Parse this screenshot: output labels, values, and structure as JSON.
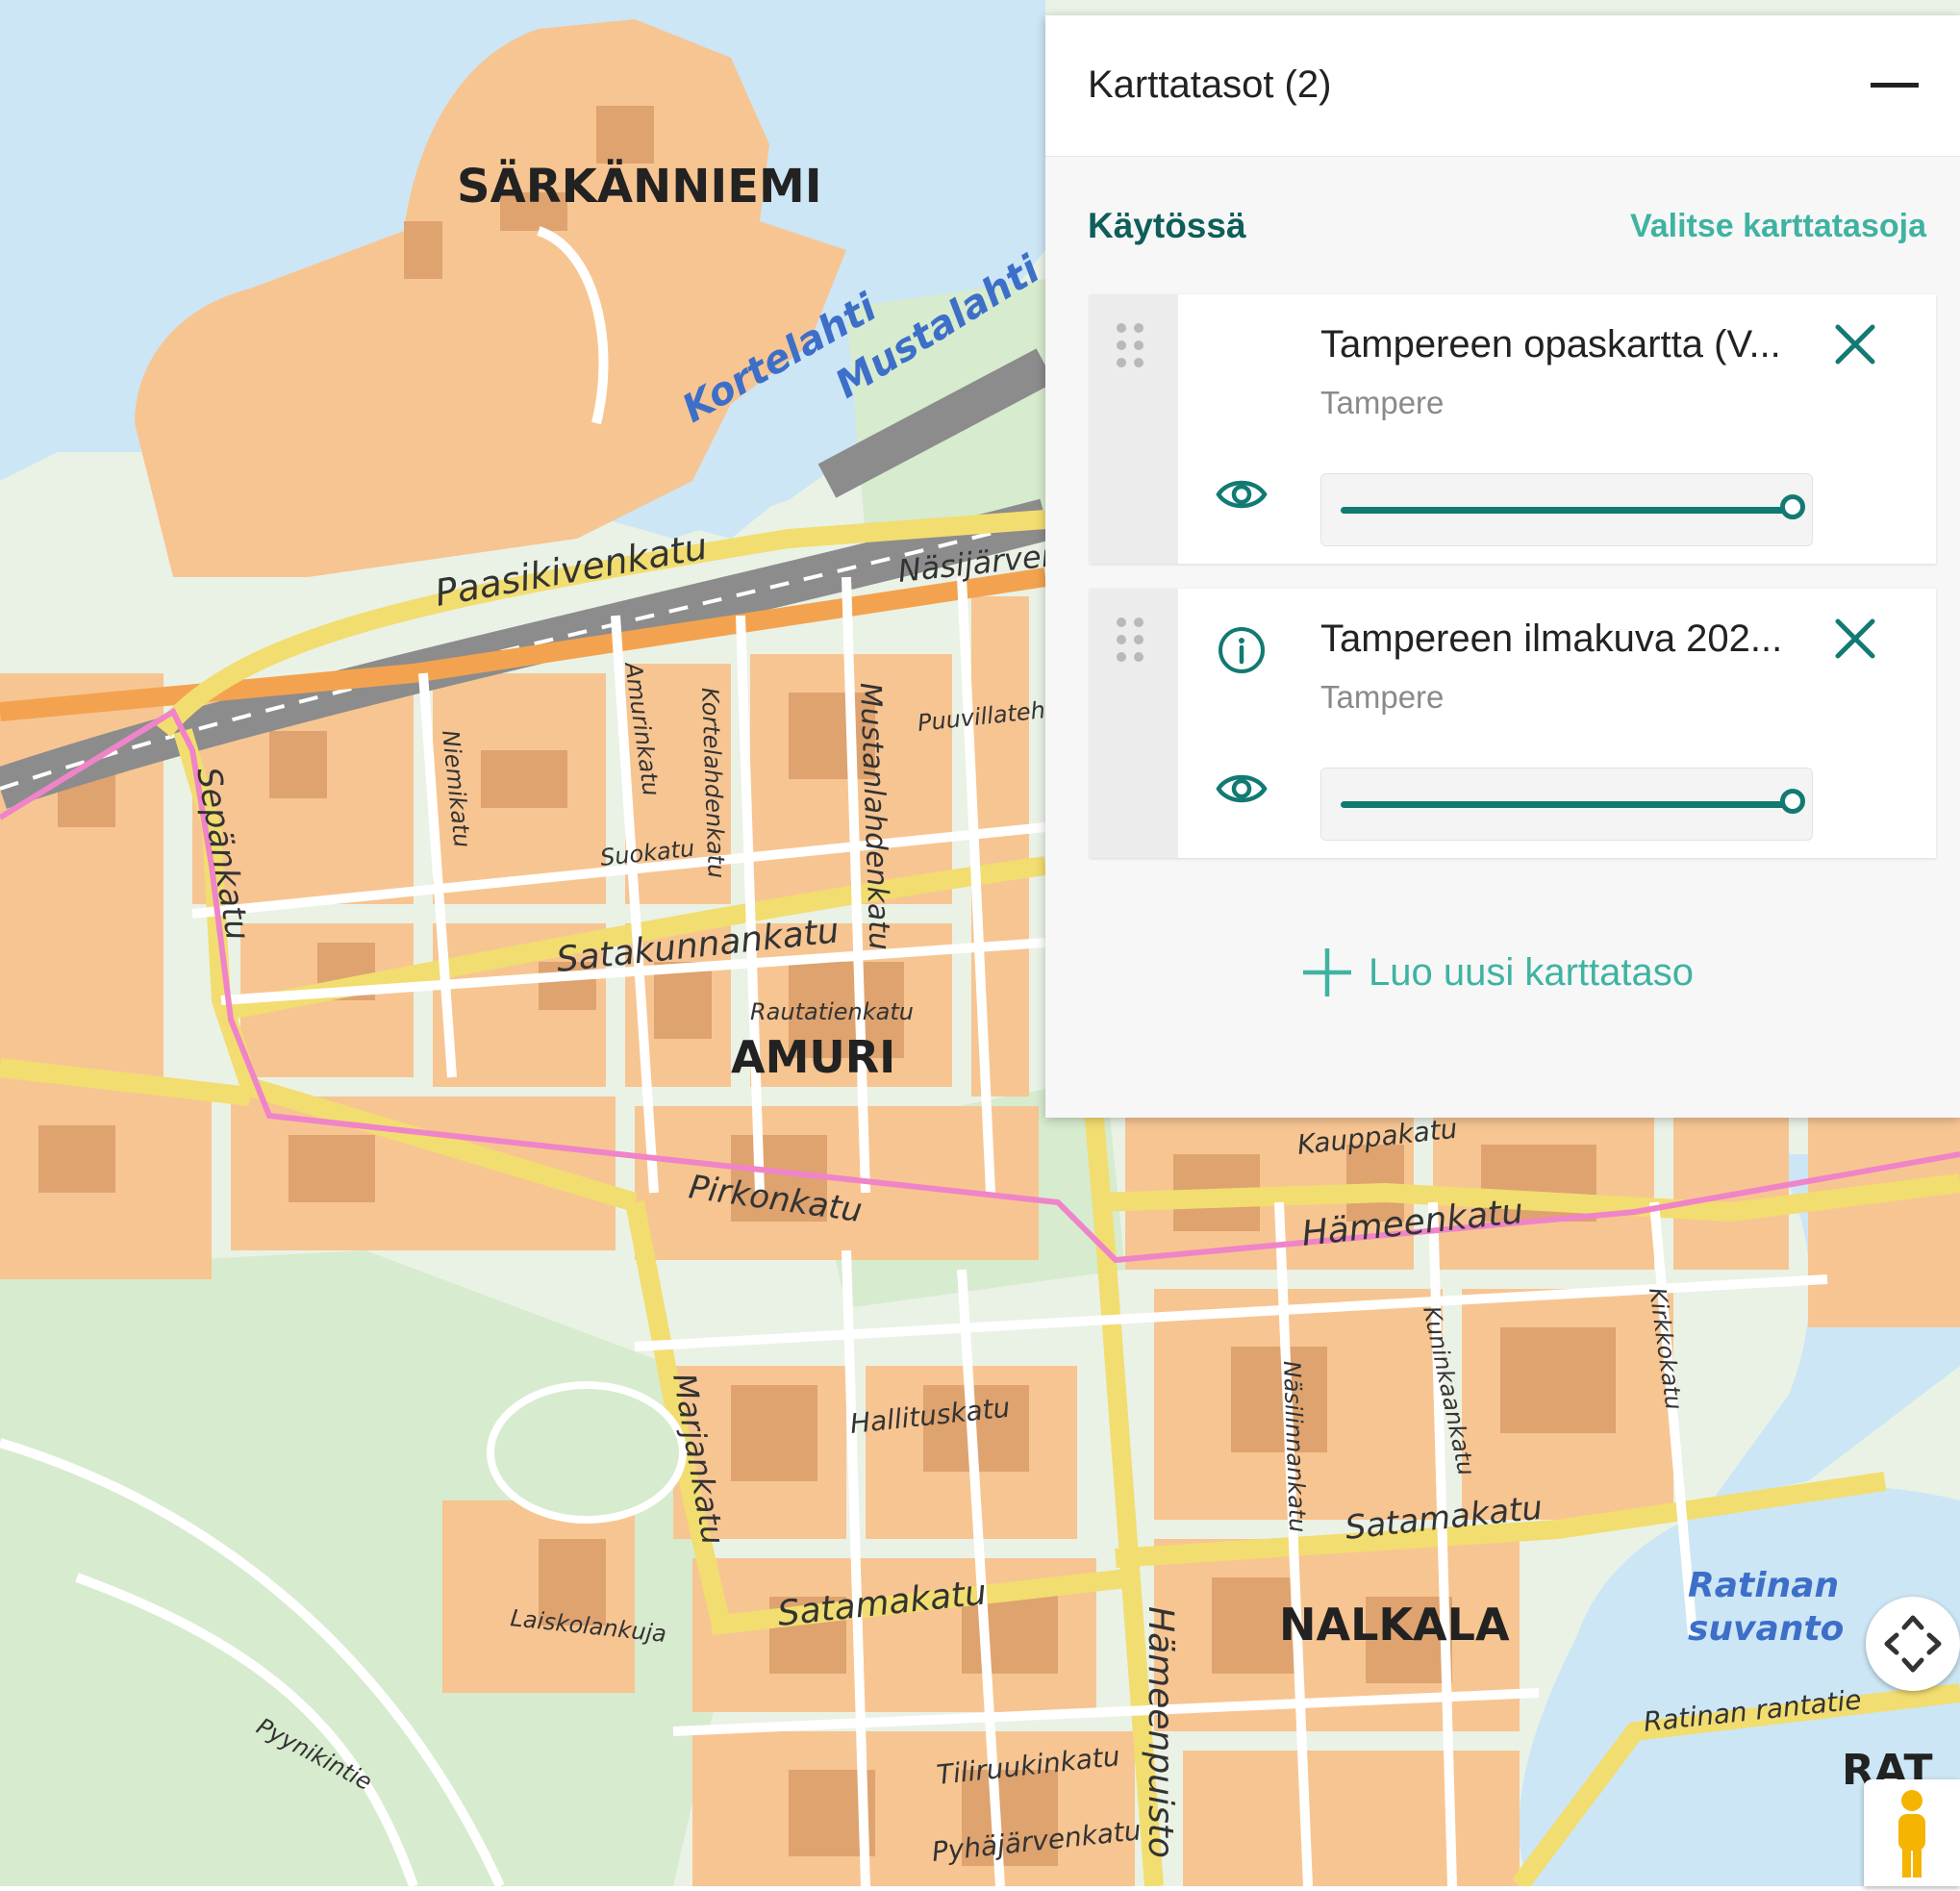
{
  "map": {
    "districts": [
      "SÄRKÄNNIEMI",
      "AMURI",
      "NALKALA"
    ],
    "water_names": [
      "Kortelahti",
      "Mustalahti",
      "Ratinan",
      "suvanto"
    ],
    "streets": [
      "Paasikivenkatu",
      "Näsijärvenkatu",
      "Satakunnankatu",
      "Pirkonkatu",
      "Hämeenkatu",
      "Hallituskatu",
      "Satamakatu",
      "Satamakatu",
      "Sepänkatu",
      "Mustanlahdenkatu",
      "Marjankatu",
      "Hämeenpuisto",
      "Pyhäjärvenkatu",
      "Tiliruukinkatu",
      "Laiskolankuja",
      "Pyynikintie",
      "Ratinan rantatie",
      "Kauppakatu",
      "Näsilinnankatu",
      "Puuvillatehtaankatu",
      "Suokatu",
      "Amurinkatu",
      "Kortelahdenkatu",
      "Niemikatu",
      "Kuninkaankatu",
      "Kirkkokatu",
      "Rautatienkatu"
    ],
    "cut_label": "RAT",
    "colors": {
      "water": "#cce6f5",
      "land": "#eaf2e6",
      "block": "#f7c592",
      "building": "#dea36f",
      "road_major": "#f2dd70",
      "road_minor": "#ffffff",
      "rail": "#8c8c8c",
      "route": "#ef84c8",
      "park": "#d7ebce"
    }
  },
  "panel": {
    "title": "Karttatasot (2)",
    "section_label": "Käytössä",
    "select_layers_link": "Valitse karttatasoja",
    "add_layer_label": "Luo uusi karttataso",
    "layers": [
      {
        "name": "Tampereen opaskartta (V...",
        "source": "Tampere",
        "opacity": 1.0,
        "has_info": false
      },
      {
        "name": "Tampereen ilmakuva 202...",
        "source": "Tampere",
        "opacity": 1.0,
        "has_info": true
      }
    ]
  },
  "icons": [
    "drag-handle-icon",
    "eye-icon",
    "info-icon",
    "close-icon",
    "plus-icon",
    "recenter-icon",
    "street-view-pegman-icon"
  ]
}
